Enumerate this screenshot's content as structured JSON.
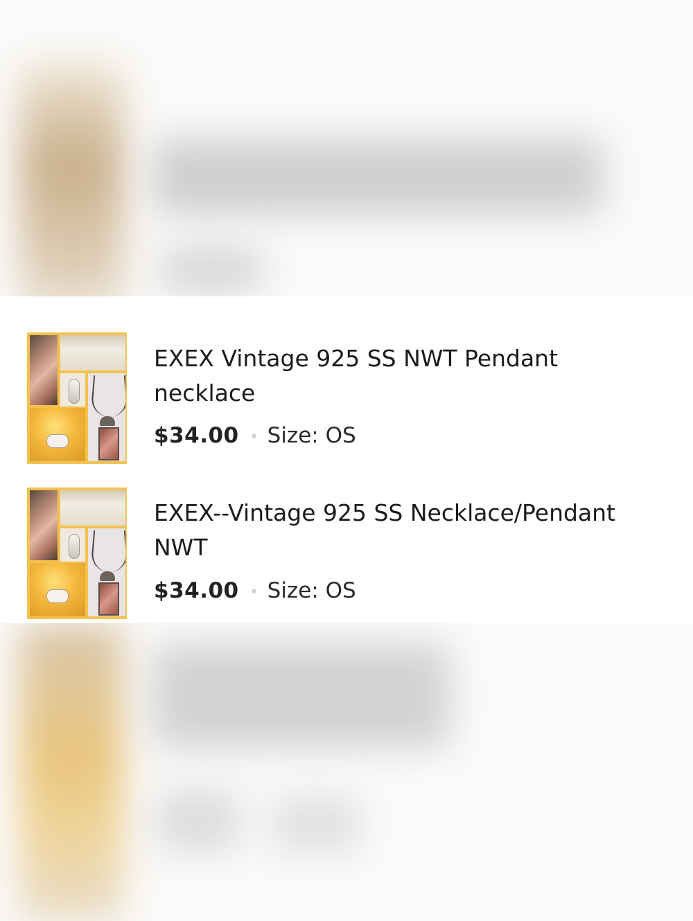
{
  "listings": [
    {
      "title": "EXEX Vintage 925 SS NWT Pendant necklace",
      "price": "$34.00",
      "size": "Size: OS"
    },
    {
      "title": "EXEX--Vintage 925 SS Necklace/Pendant NWT",
      "price": "$34.00",
      "size": "Size: OS"
    }
  ],
  "colors": {
    "thumbnail_border": "#f0c45a",
    "separator_dot": "#d4d4d4",
    "text": "#1b1b1b"
  }
}
